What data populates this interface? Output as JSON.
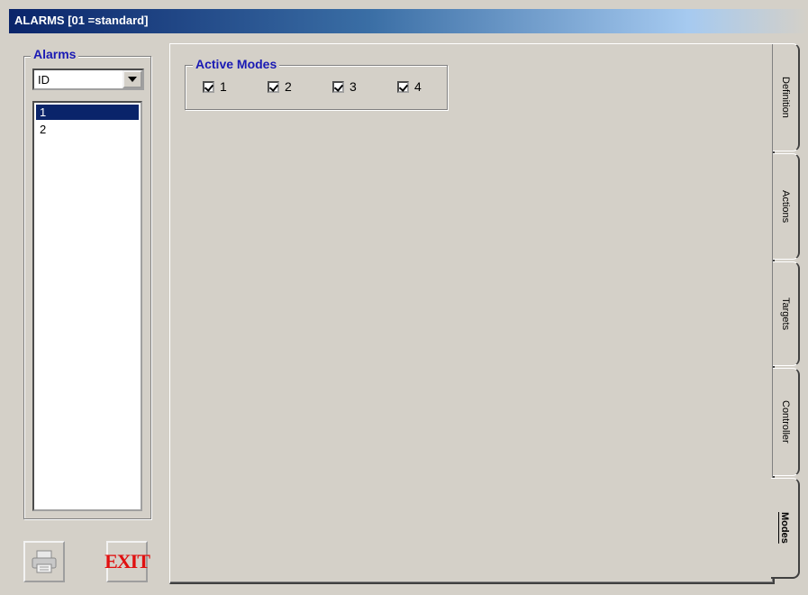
{
  "window": {
    "title": "ALARMS  [01 =standard]"
  },
  "sidebar": {
    "group_label": "Alarms",
    "combo": {
      "selected": "ID"
    },
    "items": [
      {
        "label": "1",
        "selected": true
      },
      {
        "label": "2",
        "selected": false
      }
    ],
    "buttons": {
      "print_icon": "printer-icon",
      "exit_label": "EXIT"
    }
  },
  "main": {
    "group_label": "Active Modes",
    "modes": [
      {
        "label": "1",
        "checked": true
      },
      {
        "label": "2",
        "checked": true
      },
      {
        "label": "3",
        "checked": true
      },
      {
        "label": "4",
        "checked": true
      }
    ]
  },
  "tabs": [
    {
      "label": "Definition",
      "active": false
    },
    {
      "label": "Actions",
      "active": false
    },
    {
      "label": "Targets",
      "active": false
    },
    {
      "label": "Controller",
      "active": false
    },
    {
      "label": "Modes",
      "active": true
    }
  ],
  "colors": {
    "accent": "#1a1ab4",
    "selection": "#0a246a",
    "exit": "#e01010"
  }
}
